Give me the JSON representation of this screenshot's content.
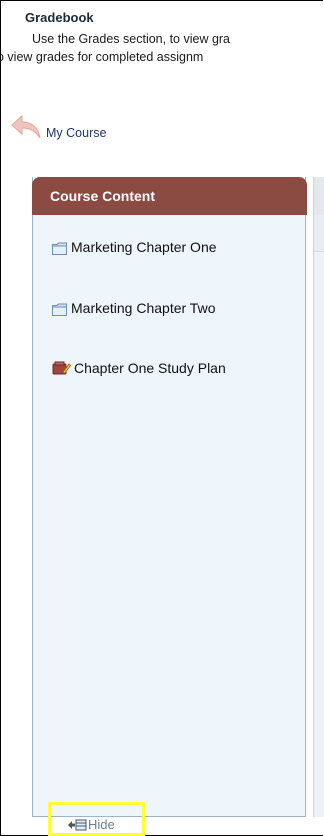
{
  "header": {
    "title": "Gradebook",
    "desc_line1": "Use the Grades section, to view gra",
    "desc_line2": "o view grades for completed assignm"
  },
  "nav": {
    "my_course": "My Course"
  },
  "course_content": {
    "heading": "Course Content",
    "items": [
      {
        "label": "Marketing Chapter One",
        "icon": "folder-icon"
      },
      {
        "label": "Marketing Chapter Two",
        "icon": "folder-icon"
      },
      {
        "label": "Chapter One Study Plan",
        "icon": "study-plan-icon"
      }
    ]
  },
  "footer": {
    "hide_label": "Hide"
  },
  "colors": {
    "panel_header": "#8b4a42",
    "panel_bg": "#eef5fb",
    "highlight": "#ffff33"
  }
}
